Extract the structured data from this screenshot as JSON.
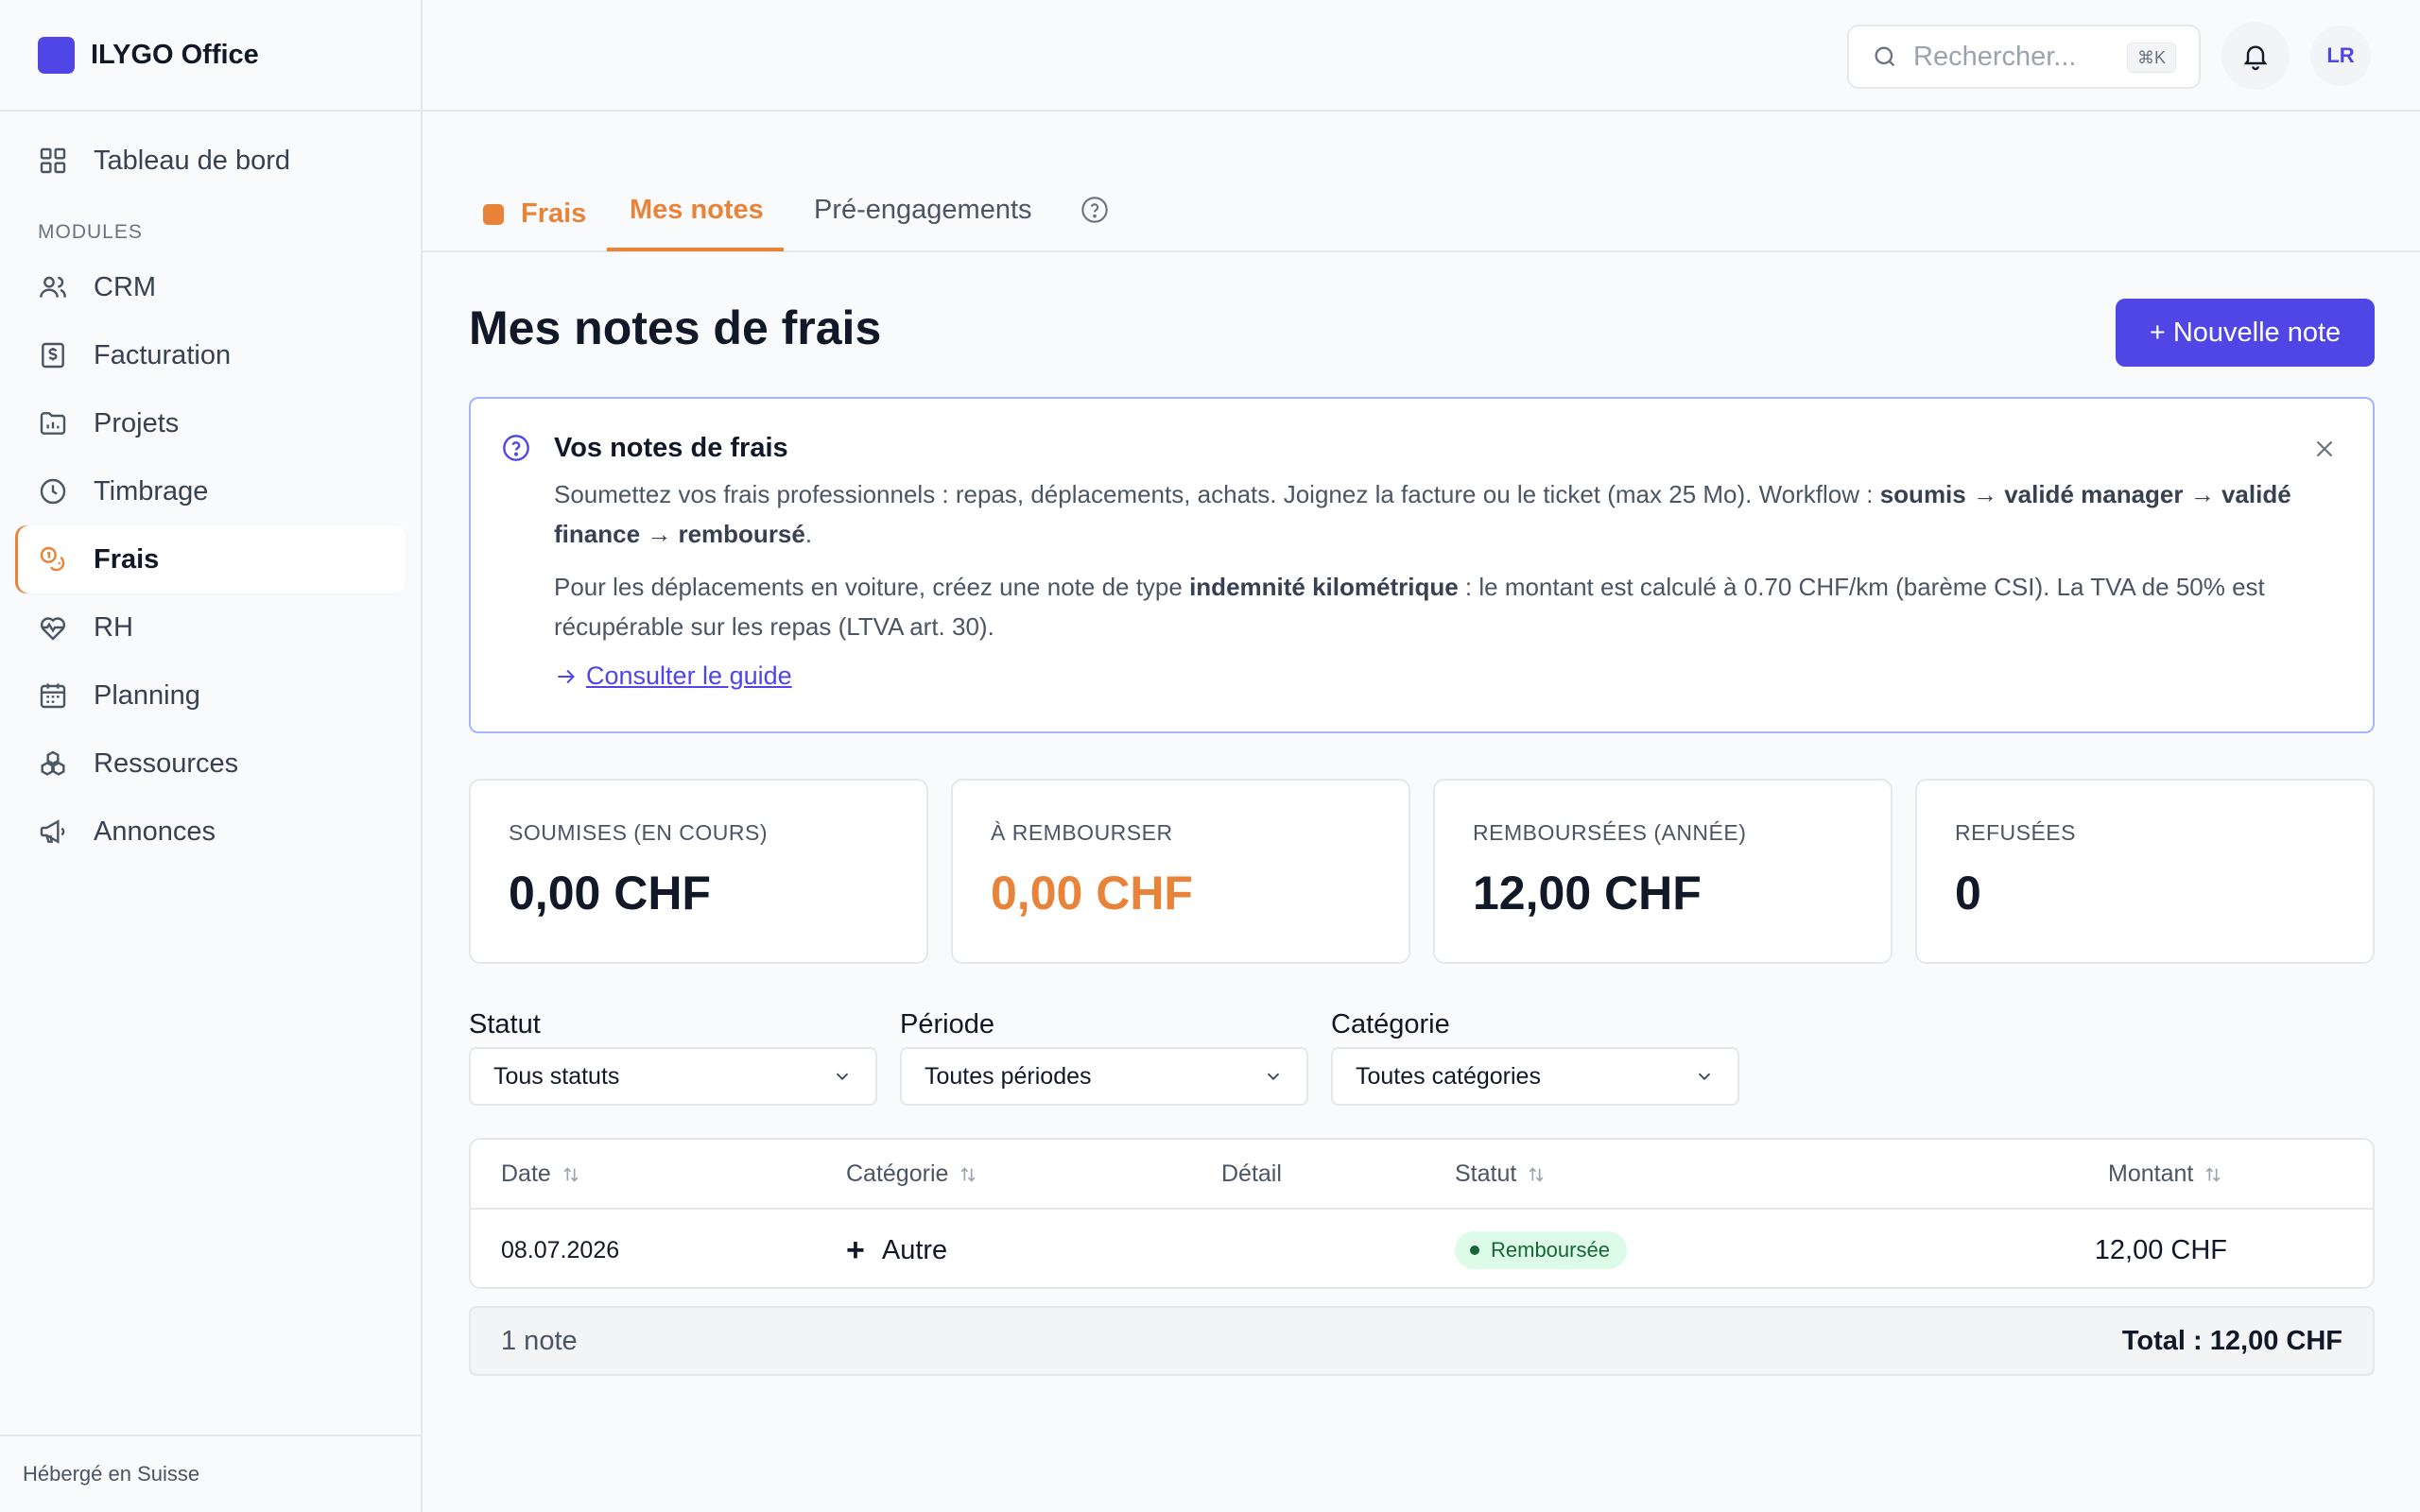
{
  "app": {
    "name": "ILYGO Office",
    "footer": "Hébergé en Suisse"
  },
  "sidebar": {
    "dashboard": {
      "label": "Tableau de bord",
      "icon": "grid-icon"
    },
    "section_label": "MODULES",
    "items": [
      {
        "label": "CRM",
        "icon": "users-icon"
      },
      {
        "label": "Facturation",
        "icon": "invoice-icon"
      },
      {
        "label": "Projets",
        "icon": "folder-icon"
      },
      {
        "label": "Timbrage",
        "icon": "clock-icon"
      },
      {
        "label": "Frais",
        "icon": "coins-icon",
        "active": true
      },
      {
        "label": "RH",
        "icon": "heart-pulse-icon"
      },
      {
        "label": "Planning",
        "icon": "calendar-icon"
      },
      {
        "label": "Ressources",
        "icon": "boxes-icon"
      },
      {
        "label": "Annonces",
        "icon": "megaphone-icon"
      }
    ]
  },
  "topbar": {
    "search_placeholder": "Rechercher...",
    "search_shortcut": "⌘K",
    "avatar_initials": "LR"
  },
  "tabs": {
    "module": "Frais",
    "items": [
      {
        "label": "Mes notes",
        "active": true
      },
      {
        "label": "Pré-engagements",
        "active": false
      }
    ]
  },
  "page": {
    "title": "Mes notes de frais",
    "new_button": "+ Nouvelle note"
  },
  "info": {
    "title": "Vos notes de frais",
    "p1_a": "Soumettez vos frais professionnels : repas, déplacements, achats. Joignez la facture ou le ticket (max 25 Mo). Workflow : ",
    "p1_b": "soumis → validé manager → validé finance → remboursé",
    "p1_c": ".",
    "p2_a": "Pour les déplacements en voiture, créez une note de type ",
    "p2_b": "indemnité kilométrique",
    "p2_c": " : le montant est calculé à 0.70 CHF/km (barème CSI). La TVA de 50% est récupérable sur les repas (LTVA art. 30).",
    "link": "Consulter le guide"
  },
  "stats": [
    {
      "label": "SOUMISES (EN COURS)",
      "value": "0,00 CHF",
      "accent": false
    },
    {
      "label": "À REMBOURSER",
      "value": "0,00 CHF",
      "accent": true
    },
    {
      "label": "REMBOURSÉES (ANNÉE)",
      "value": "12,00 CHF",
      "accent": false
    },
    {
      "label": "REFUSÉES",
      "value": "0",
      "accent": false
    }
  ],
  "filters": [
    {
      "label": "Statut",
      "value": "Tous statuts"
    },
    {
      "label": "Période",
      "value": "Toutes périodes"
    },
    {
      "label": "Catégorie",
      "value": "Toutes catégories"
    }
  ],
  "table": {
    "columns": [
      "Date",
      "Catégorie",
      "Détail",
      "Statut",
      "Montant"
    ],
    "rows": [
      {
        "date": "08.07.2026",
        "category_icon": "+",
        "category": "Autre",
        "detail": "",
        "status": "Remboursée",
        "amount": "12,00 CHF"
      }
    ],
    "count": "1 note",
    "total": "Total : 12,00 CHF"
  },
  "colors": {
    "accent": "#4f46e5",
    "module": "#e8833a",
    "success_bg": "#dcfce7",
    "success_fg": "#166534"
  }
}
